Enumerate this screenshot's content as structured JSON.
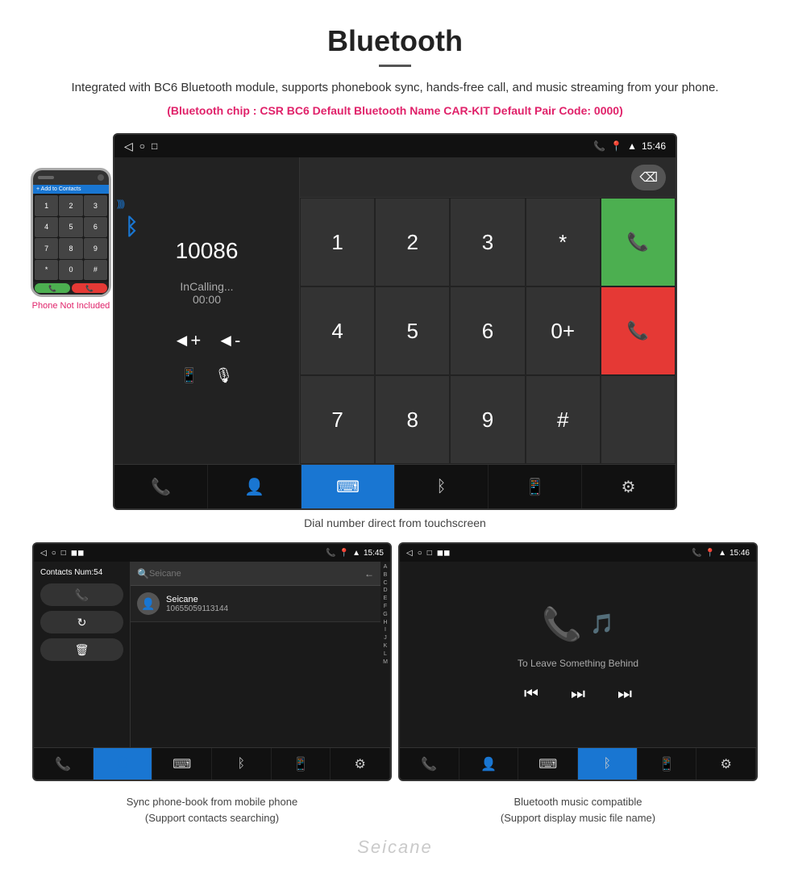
{
  "page": {
    "title": "Bluetooth",
    "divider": true,
    "description": "Integrated with BC6 Bluetooth module, supports phonebook sync, hands-free call, and music streaming from your phone.",
    "specs": "(Bluetooth chip : CSR BC6    Default Bluetooth Name CAR-KIT    Default Pair Code: 0000)"
  },
  "dial_screen": {
    "status_bar": {
      "time": "15:46",
      "nav_back": "◁",
      "nav_home": "○",
      "nav_recent": "□"
    },
    "number": "10086",
    "call_status": "InCalling...",
    "call_time": "00:00",
    "vol_up": "◄+",
    "vol_down": "◄-",
    "keypad": [
      "1",
      "2",
      "3",
      "*",
      "",
      "4",
      "5",
      "6",
      "0+",
      "",
      "7",
      "8",
      "9",
      "#",
      ""
    ],
    "caption": "Dial number direct from touchscreen"
  },
  "contacts_screen": {
    "status_bar": {
      "time": "15:45"
    },
    "contacts_num": "Contacts Num:54",
    "search_placeholder": "Seicane",
    "search_number": "10655059113144",
    "alphabet": [
      "A",
      "B",
      "C",
      "D",
      "E",
      "F",
      "G",
      "H",
      "I",
      "J",
      "K",
      "L",
      "M"
    ],
    "caption_line1": "Sync phone-book from mobile phone",
    "caption_line2": "(Support contacts searching)"
  },
  "music_screen": {
    "status_bar": {
      "time": "15:46"
    },
    "song_title": "To Leave Something Behind",
    "caption_line1": "Bluetooth music compatible",
    "caption_line2": "(Support display music file name)"
  },
  "phone_mockup": {
    "not_included": "Phone Not Included"
  },
  "watermark": "Seicane",
  "bottom_nav": {
    "items": [
      "phone-icon",
      "contacts-icon",
      "keypad-icon",
      "bluetooth-icon",
      "phone-out-icon",
      "settings-icon"
    ]
  }
}
